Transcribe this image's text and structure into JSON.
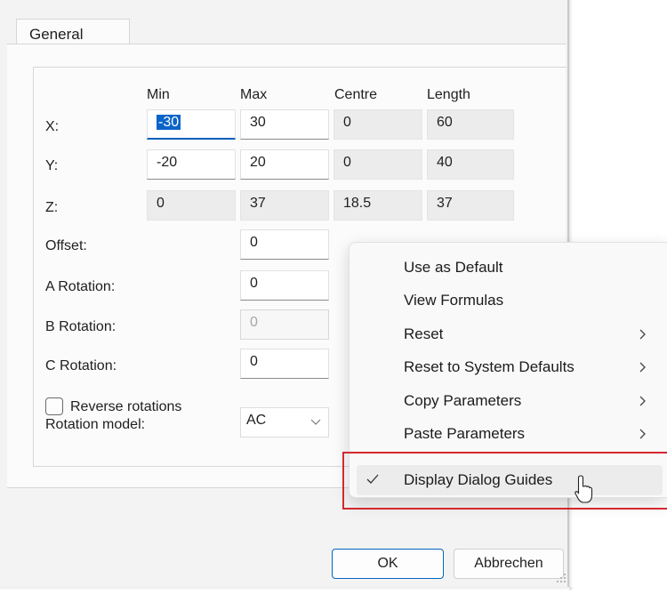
{
  "tab": {
    "label": "General"
  },
  "grid": {
    "headers": [
      "Min",
      "Max",
      "Centre",
      "Length"
    ],
    "rows": [
      {
        "label": "X:",
        "min": "-30",
        "max": "30",
        "centre": "0",
        "length": "60"
      },
      {
        "label": "Y:",
        "min": "-20",
        "max": "20",
        "centre": "0",
        "length": "40"
      },
      {
        "label": "Z:",
        "min": "0",
        "max": "37",
        "centre": "18.5",
        "length": "37"
      }
    ]
  },
  "offset": {
    "label": "Offset:",
    "value": "0"
  },
  "a_rotation": {
    "label": "A Rotation:",
    "value": "0"
  },
  "b_rotation": {
    "label": "B Rotation:",
    "value": "0"
  },
  "c_rotation": {
    "label": "C Rotation:",
    "value": "0"
  },
  "reverse_rotations": {
    "label": "Reverse rotations",
    "checked": false
  },
  "rotation_model": {
    "label": "Rotation model:",
    "value": "AC"
  },
  "buttons": {
    "ok": "OK",
    "cancel": "Abbrechen"
  },
  "context_menu": {
    "items": [
      {
        "label": "Use as Default",
        "submenu": false
      },
      {
        "label": "View Formulas",
        "submenu": false
      },
      {
        "label": "Reset",
        "submenu": true
      },
      {
        "label": "Reset to System Defaults",
        "submenu": true
      },
      {
        "label": "Copy Parameters",
        "submenu": true
      },
      {
        "label": "Paste Parameters",
        "submenu": true
      },
      {
        "label": "Display Dialog Guides",
        "submenu": false,
        "checked": true
      }
    ]
  },
  "colors": {
    "accent": "#005fb8",
    "highlight_box": "#d3282f",
    "selection": "#0a64c8"
  }
}
